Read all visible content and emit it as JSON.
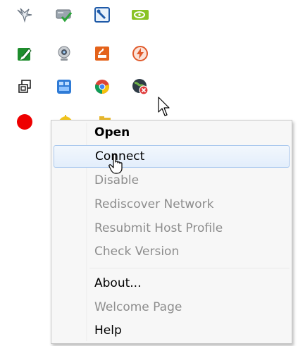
{
  "tray_icons": [
    {
      "name": "bird-icon"
    },
    {
      "name": "drive-check-icon"
    },
    {
      "name": "tool-window-icon"
    },
    {
      "name": "nvidia-icon"
    },
    {
      "name": "green-pencil-icon"
    },
    {
      "name": "webcam-icon"
    },
    {
      "name": "orange-tool-icon"
    },
    {
      "name": "flash-icon"
    },
    {
      "name": "overlap-windows-icon"
    },
    {
      "name": "blue-grid-icon"
    },
    {
      "name": "chrome-icon"
    },
    {
      "name": "globe-disconnected-icon"
    },
    {
      "name": "red-dot-icon"
    },
    {
      "name": "yellow-icon"
    },
    {
      "name": "yellow-folder-icon"
    }
  ],
  "context_menu": {
    "items": [
      {
        "label": "Open",
        "bold": true,
        "enabled": true
      },
      {
        "label": "Connect",
        "bold": false,
        "enabled": true,
        "hover": true
      },
      {
        "label": "Disable",
        "bold": false,
        "enabled": false
      },
      {
        "label": "Rediscover Network",
        "bold": false,
        "enabled": false
      },
      {
        "label": "Resubmit Host Profile",
        "bold": false,
        "enabled": false
      },
      {
        "label": "Check Version",
        "bold": false,
        "enabled": false
      },
      {
        "label": "About...",
        "bold": false,
        "enabled": true
      },
      {
        "label": "Welcome Page",
        "bold": false,
        "enabled": false
      },
      {
        "label": "Help",
        "bold": false,
        "enabled": true
      }
    ]
  },
  "colors": {
    "menu_background": "#f7f7f7",
    "menu_border": "#c8c8c8",
    "disabled_text": "#8d8d8d",
    "hover_border": "#a9c8ee"
  }
}
